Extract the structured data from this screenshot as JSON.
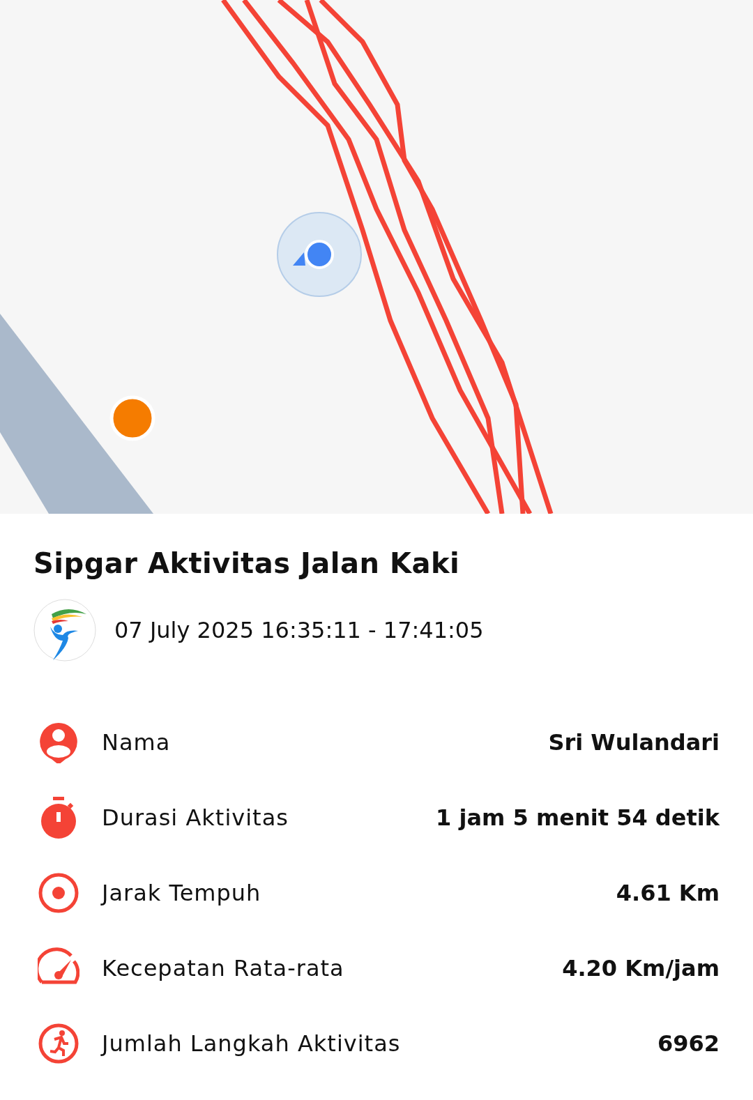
{
  "title": "Sipgar Aktivitas Jalan Kaki",
  "time_range": "07 July 2025 16:35:11 - 17:41:05",
  "stats": [
    {
      "kind": "person",
      "label": "Nama",
      "value": "Sri Wulandari"
    },
    {
      "kind": "timer",
      "label": "Durasi Aktivitas",
      "value": "1 jam 5 menit 54 detik"
    },
    {
      "kind": "target",
      "label": "Jarak Tempuh",
      "value": "4.61 Km"
    },
    {
      "kind": "speed",
      "label": "Kecepatan Rata-rata",
      "value": "4.20 Km/jam"
    },
    {
      "kind": "steps",
      "label": "Jumlah Langkah Aktivitas",
      "value": "6962"
    }
  ]
}
